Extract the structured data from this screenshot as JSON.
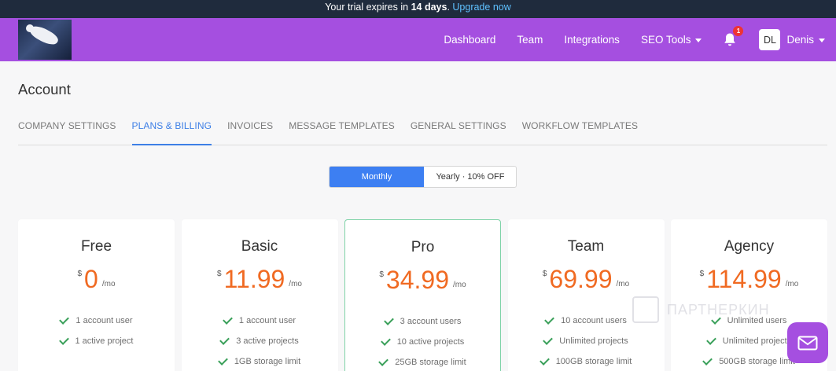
{
  "trial": {
    "prefix": "Your trial expires in ",
    "days": "14 days",
    "suffix": ". ",
    "link": "Upgrade now"
  },
  "nav": {
    "links": [
      "Dashboard",
      "Team",
      "Integrations",
      "SEO Tools"
    ],
    "notification_count": "1",
    "avatar_initials": "DL",
    "user_name": "Denis"
  },
  "page_title": "Account",
  "tabs": [
    "COMPANY SETTINGS",
    "PLANS & BILLING",
    "INVOICES",
    "MESSAGE TEMPLATES",
    "GENERAL SETTINGS",
    "WORKFLOW TEMPLATES"
  ],
  "active_tab": "PLANS & BILLING",
  "billing_toggle": {
    "monthly": "Monthly",
    "yearly": "Yearly · 10% OFF",
    "selected": "Monthly"
  },
  "plans": [
    {
      "name": "Free",
      "currency": "$",
      "price": "0",
      "period": "/mo",
      "features": [
        "1 account user",
        "1 active project"
      ]
    },
    {
      "name": "Basic",
      "currency": "$",
      "price": "11.99",
      "period": "/mo",
      "features": [
        "1 account user",
        "3 active projects",
        "1GB storage limit"
      ]
    },
    {
      "name": "Pro",
      "currency": "$",
      "price": "34.99",
      "period": "/mo",
      "features": [
        "3 account users",
        "10 active projects",
        "25GB storage limit"
      ]
    },
    {
      "name": "Team",
      "currency": "$",
      "price": "69.99",
      "period": "/mo",
      "features": [
        "10 account users",
        "Unlimited projects",
        "100GB storage limit"
      ]
    },
    {
      "name": "Agency",
      "currency": "$",
      "price": "114.99",
      "period": "/mo",
      "features": [
        "Unlimited users",
        "Unlimited projects",
        "500GB storage limit"
      ]
    }
  ],
  "watermark": "ПАРТНЕРКИН",
  "colors": {
    "nav_bg": "#a54fe0",
    "trial_bg": "#1f2b3d",
    "accent_blue": "#3d7fe6",
    "price_orange": "#f06a22",
    "check_green": "#3aa05a"
  },
  "icons": {
    "bell": "bell-icon",
    "chat": "envelope-icon",
    "check": "check-icon"
  }
}
